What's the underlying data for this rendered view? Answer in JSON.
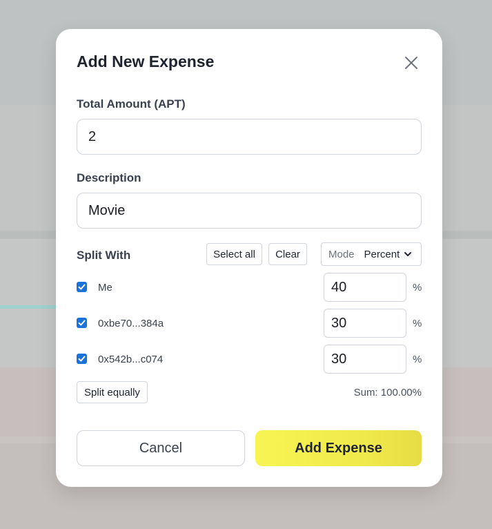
{
  "modal": {
    "title": "Add New Expense",
    "close_icon": "close-icon"
  },
  "amount": {
    "label": "Total Amount (APT)",
    "value": "2"
  },
  "description": {
    "label": "Description",
    "value": "Movie"
  },
  "split": {
    "label": "Split With",
    "select_all_label": "Select all",
    "clear_label": "Clear",
    "mode_label": "Mode",
    "mode_value": "Percent",
    "members": [
      {
        "name": "Me",
        "checked": true,
        "percent": "40",
        "unit": "%"
      },
      {
        "name": "0xbe70...384a",
        "checked": true,
        "percent": "30",
        "unit": "%"
      },
      {
        "name": "0x542b...c074",
        "checked": true,
        "percent": "30",
        "unit": "%"
      }
    ],
    "split_equally_label": "Split equally",
    "sum_text": "Sum: 100.00%"
  },
  "actions": {
    "cancel_label": "Cancel",
    "add_label": "Add Expense"
  },
  "colors": {
    "checkbox": "#1a73d9",
    "primary_button": "#f7f553",
    "overlay": "#c3c7c6"
  }
}
